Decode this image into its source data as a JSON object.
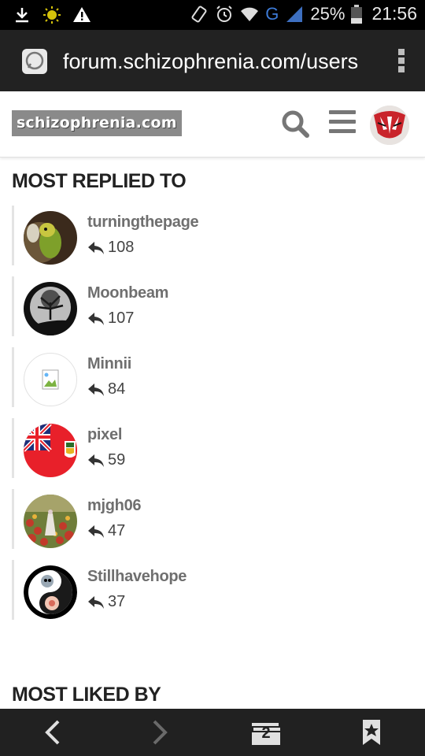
{
  "status_bar": {
    "battery_pct": "25%",
    "time": "21:56",
    "network": "G"
  },
  "browser": {
    "url": "forum.schizophrenia.com/users",
    "tab_count": "2"
  },
  "site": {
    "logo_text": "schizophrenia.com"
  },
  "sections": {
    "most_replied_title": "MOST REPLIED TO",
    "most_liked_title": "MOST LIKED BY"
  },
  "most_replied": [
    {
      "name": "turningthepage",
      "count": "108"
    },
    {
      "name": "Moonbeam",
      "count": "107"
    },
    {
      "name": "Minnii",
      "count": "84"
    },
    {
      "name": "pixel",
      "count": "59"
    },
    {
      "name": "mjgh06",
      "count": "47"
    },
    {
      "name": "Stillhavehope",
      "count": "37"
    }
  ],
  "icons": {
    "search": "search-icon",
    "menu": "hamburger-menu-icon",
    "reply": "reply-icon",
    "back": "chevron-left-icon",
    "forward": "chevron-right-icon",
    "tabs": "tabs-icon",
    "bookmark": "bookmark-star-icon"
  },
  "colors": {
    "status_bar_bg": "#000000",
    "url_bar_bg": "#222222",
    "bottom_bar_bg": "#212121",
    "logo_bg": "#8a8a8a",
    "username": "#6f6f6f"
  }
}
